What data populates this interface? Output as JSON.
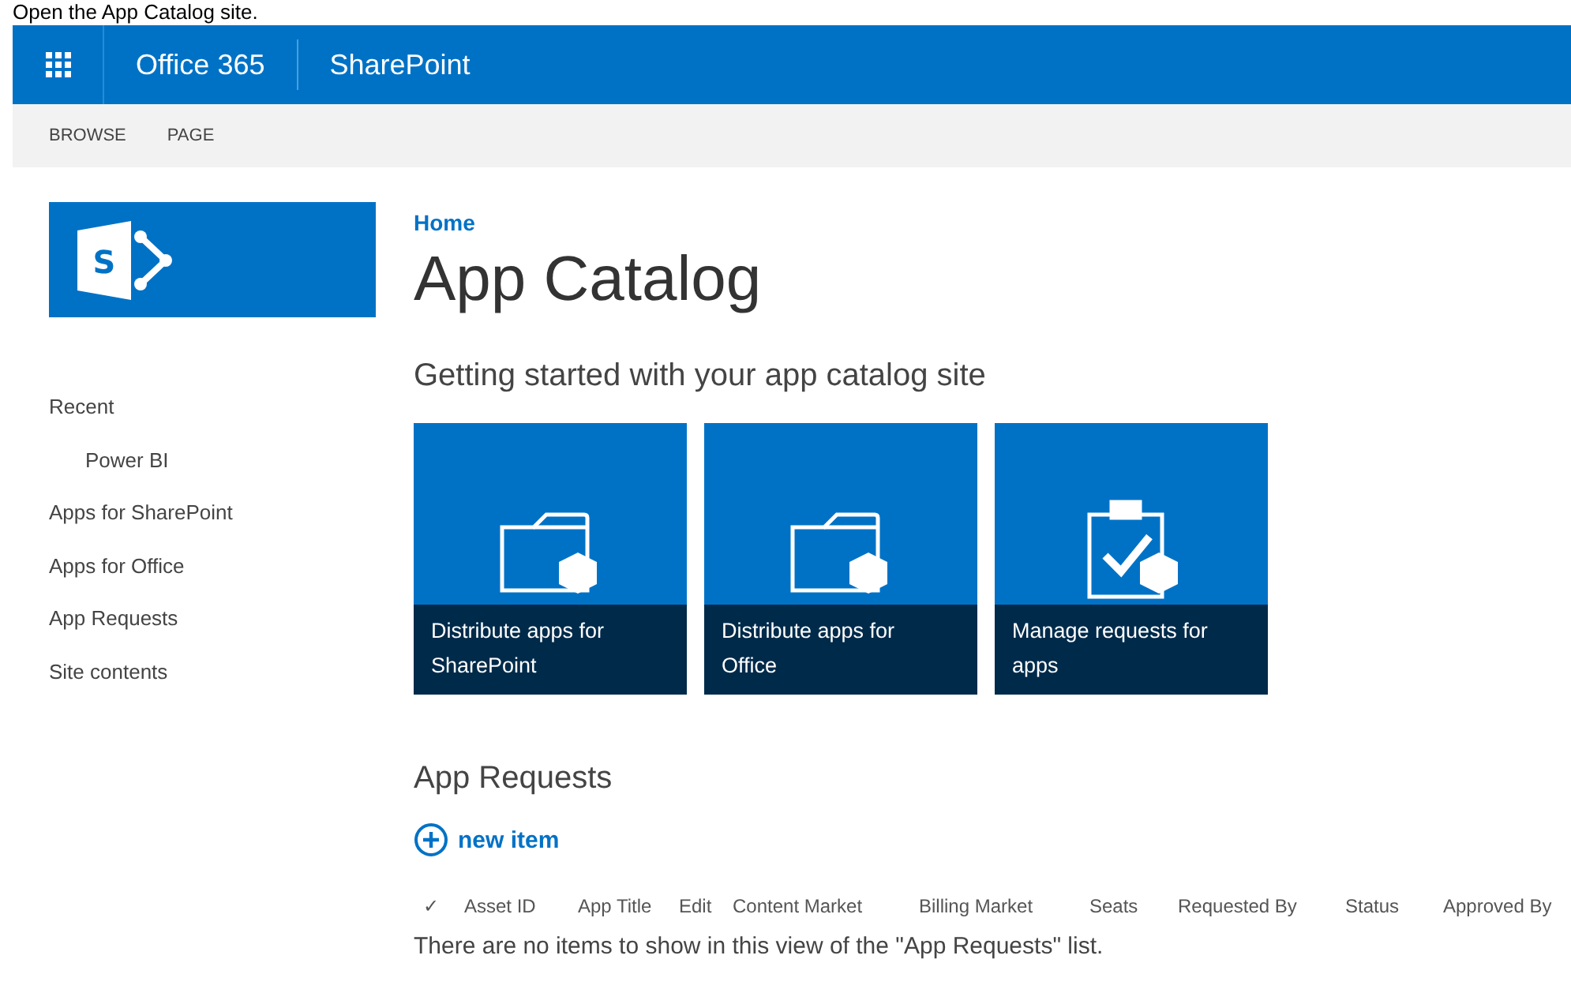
{
  "caption": "Open the App Catalog site.",
  "suite_bar": {
    "brand": "Office 365",
    "app": "SharePoint"
  },
  "logo_letter": "S",
  "ribbon_tabs": [
    {
      "label": "BROWSE"
    },
    {
      "label": "PAGE"
    }
  ],
  "nav": [
    {
      "label": "Recent",
      "children": [
        {
          "label": "Power BI"
        }
      ]
    },
    {
      "label": "Apps for SharePoint"
    },
    {
      "label": "Apps for Office"
    },
    {
      "label": "App Requests"
    },
    {
      "label": "Site contents"
    }
  ],
  "breadcrumb": "Home",
  "page_title": "App Catalog",
  "getting_started": {
    "heading": "Getting started with your app catalog site",
    "tiles": [
      {
        "kind": "folder",
        "label": "Distribute apps for SharePoint"
      },
      {
        "kind": "folder",
        "label": "Distribute apps for Office"
      },
      {
        "kind": "clipboard",
        "label": "Manage requests for apps"
      }
    ]
  },
  "list": {
    "heading": "App Requests",
    "new_item": "new item",
    "columns": [
      "✓",
      "Asset ID",
      "App Title",
      "Edit",
      "Content Market",
      "Billing Market",
      "Seats",
      "Requested By",
      "Status",
      "Approved By"
    ],
    "empty_message": "There are no items to show in this view of the \"App Requests\" list."
  }
}
